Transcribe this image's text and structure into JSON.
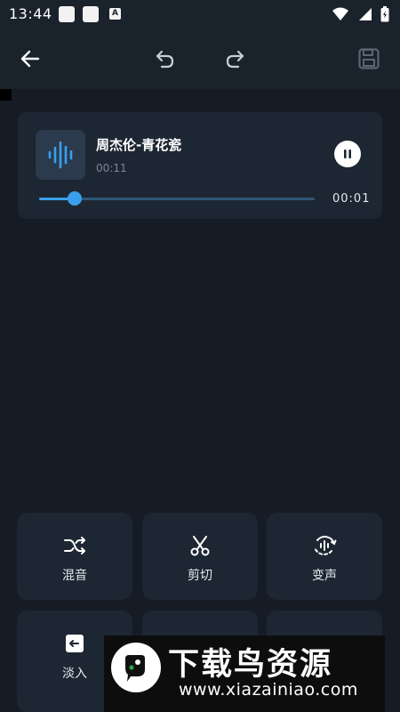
{
  "status_bar": {
    "time": "13:44",
    "notif_letter": "A"
  },
  "player": {
    "title": "周杰伦-青花瓷",
    "duration": "00:11",
    "current_time": "00:01",
    "progress": 0.13
  },
  "tools": [
    {
      "label": "混音",
      "icon": "shuffle-icon"
    },
    {
      "label": "剪切",
      "icon": "scissors-icon"
    },
    {
      "label": "变声",
      "icon": "voice-change-icon"
    },
    {
      "label": "淡入",
      "icon": "fade-in-icon"
    }
  ],
  "watermark": {
    "name": "下载鸟资源",
    "url": "www.xiazainiao.com"
  },
  "colors": {
    "accent": "#3aa0ee",
    "background": "#151c25",
    "card": "#1d2733"
  }
}
